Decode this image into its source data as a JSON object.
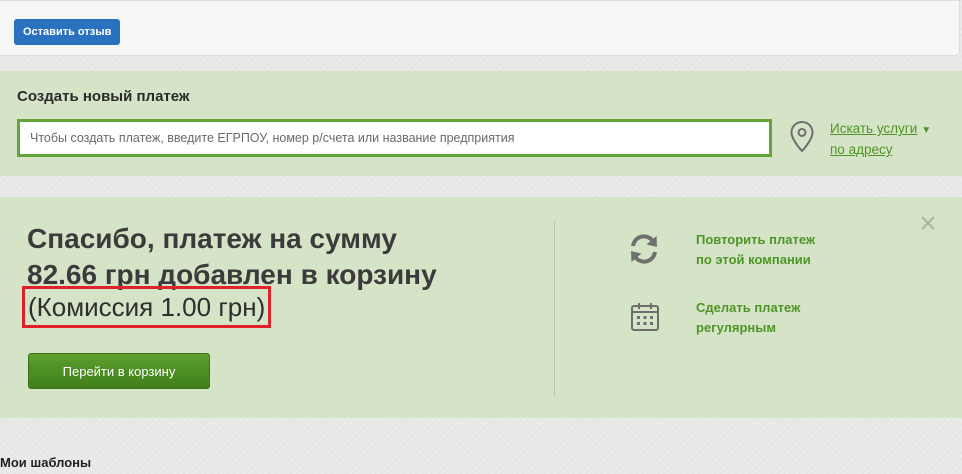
{
  "review": {
    "button_label": "Оставить отзыв"
  },
  "create_payment": {
    "title": "Создать новый платеж",
    "search_placeholder": "Чтобы создать платеж, введите ЕГРПОУ, номер р/счета или название предприятия",
    "address_link_line1": "Искать услуги",
    "address_link_line2": "по адресу",
    "caret": "▼"
  },
  "success": {
    "thanks_line1": "Спасибо,  платеж на сумму",
    "thanks_line2": "82.66 грн  добавлен в корзину",
    "commission": "(Комиссия 1.00 грн)",
    "cart_button": "Перейти в корзину",
    "repeat_line1": "Повторить платеж",
    "repeat_line2": "по этой компании",
    "regular_line1": "Сделать платеж",
    "regular_line2": "регулярным"
  },
  "templates": {
    "title": "Мои шаблоны"
  },
  "colors": {
    "accent_green": "#4f9427",
    "panel_green": "#d5e4c7",
    "button_blue": "#2a72c0",
    "highlight_red": "#e0212a"
  },
  "icons": {
    "pin": "map-pin-icon",
    "repeat": "refresh-icon",
    "calendar": "calendar-icon",
    "close": "close-icon"
  }
}
